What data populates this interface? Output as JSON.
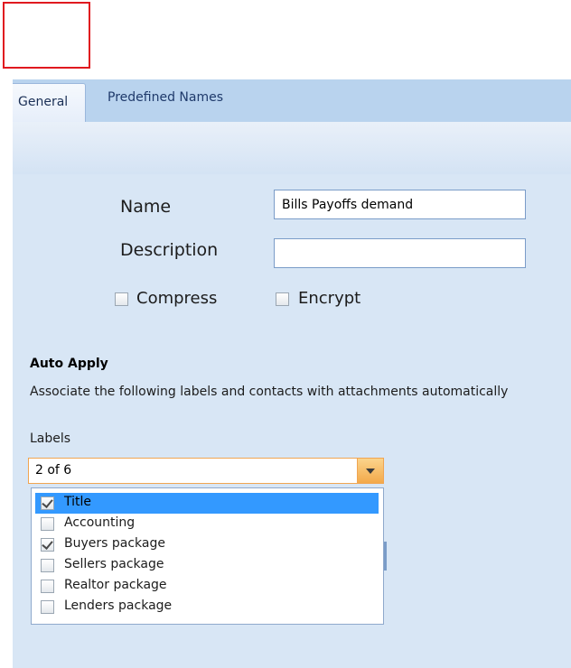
{
  "tabs": [
    {
      "label": "General",
      "active": true
    },
    {
      "label": "Predefined Names",
      "active": false
    }
  ],
  "form": {
    "name_label": "Name",
    "name_value": "Bills Payoffs demand",
    "description_label": "Description",
    "description_value": "",
    "compress_label": "Compress",
    "compress_checked": false,
    "encrypt_label": "Encrypt",
    "encrypt_checked": false
  },
  "auto_apply": {
    "title": "Auto Apply",
    "description": "Associate the following labels and contacts with attachments automatically",
    "labels_caption": "Labels",
    "labels_selected_text": "2 of 6",
    "label_items": [
      {
        "label": "Title",
        "checked": true,
        "highlighted": true
      },
      {
        "label": "Accounting",
        "checked": false,
        "highlighted": false
      },
      {
        "label": "Buyers package",
        "checked": true,
        "highlighted": false
      },
      {
        "label": "Sellers package",
        "checked": false,
        "highlighted": false
      },
      {
        "label": "Realtor package",
        "checked": false,
        "highlighted": false
      },
      {
        "label": "Lenders package",
        "checked": false,
        "highlighted": false
      }
    ]
  },
  "colors": {
    "panel_bg": "#d8e6f5",
    "highlight": "#3399ff",
    "combo_border": "#f0a552",
    "annotation": "#e0191f"
  }
}
